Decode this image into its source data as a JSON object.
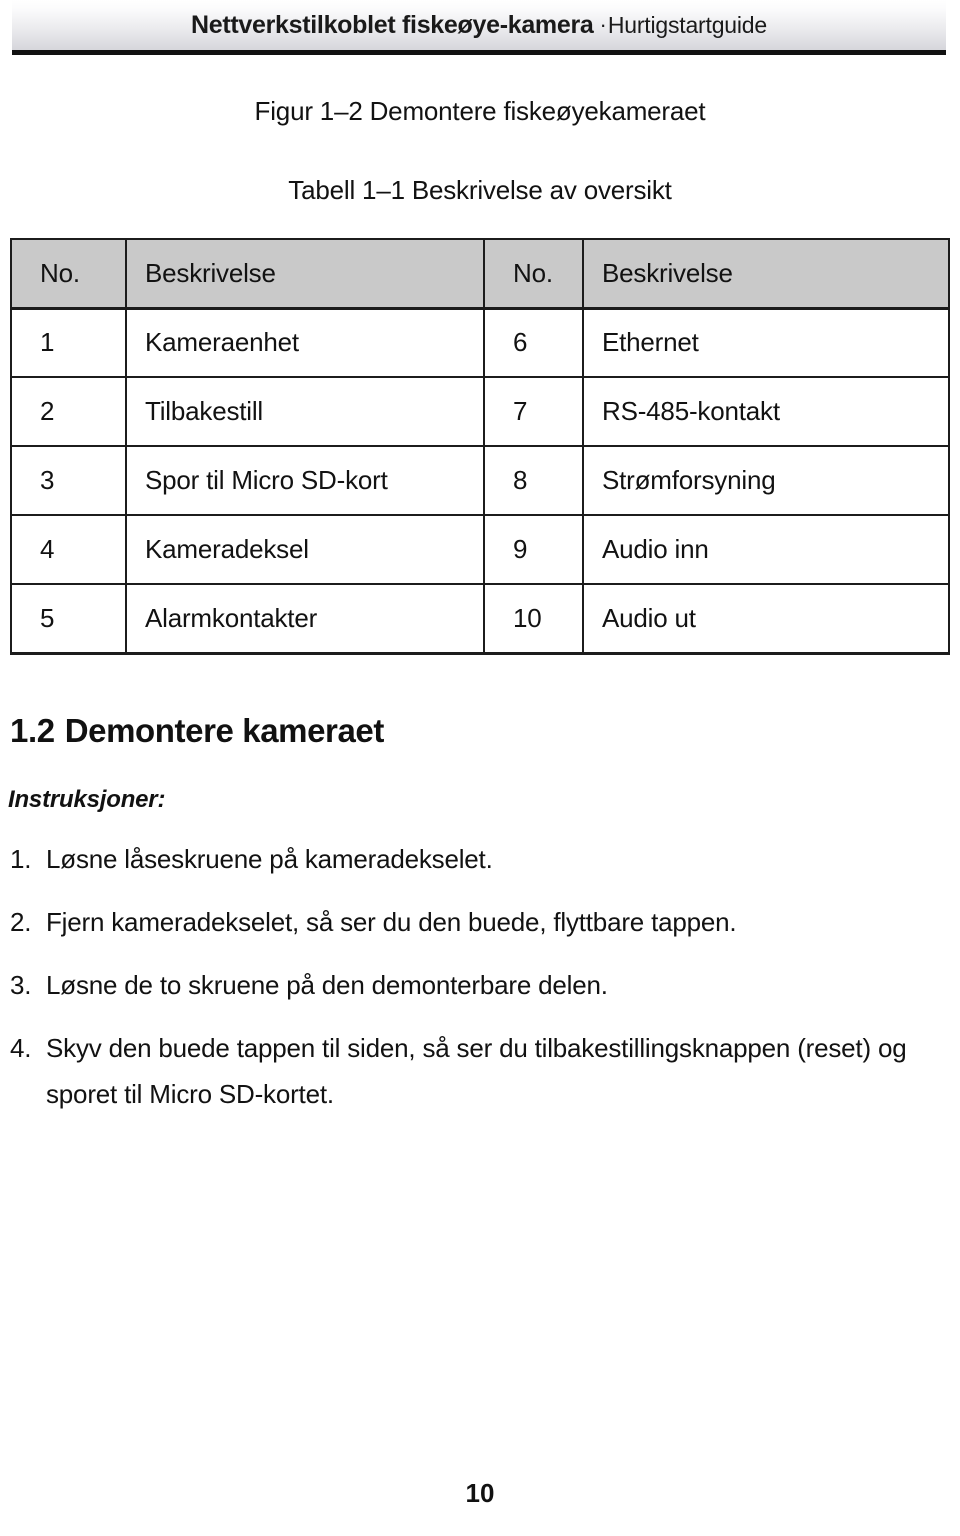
{
  "header": {
    "title_strong": "Nettverkstilkoblet fiskeøye-kamera",
    "separator": "·",
    "title_light": "Hurtigstartguide"
  },
  "figure_caption": "Figur 1–2 Demontere fiskeøyekameraet",
  "table_caption": "Tabell 1–1 Beskrivelse av oversikt",
  "table": {
    "headers": [
      "No.",
      "Beskrivelse",
      "No.",
      "Beskrivelse"
    ],
    "rows": [
      [
        "1",
        "Kameraenhet",
        "6",
        "Ethernet"
      ],
      [
        "2",
        "Tilbakestill",
        "7",
        "RS-485-kontakt"
      ],
      [
        "3",
        "Spor til Micro SD-kort",
        "8",
        "Strømforsyning"
      ],
      [
        "4",
        "Kameradeksel",
        "9",
        "Audio inn"
      ],
      [
        "5",
        "Alarmkontakter",
        "10",
        "Audio ut"
      ]
    ]
  },
  "section": {
    "number": "1.2",
    "title": "Demontere kameraet",
    "instructions_label": "Instruksjoner:",
    "steps": [
      {
        "num": "1.",
        "text": "Løsne låseskruene på kameradekselet."
      },
      {
        "num": "2.",
        "text": "Fjern kameradekselet, så ser du den buede, flyttbare tappen."
      },
      {
        "num": "3.",
        "text": "Løsne de to skruene på den demonterbare delen."
      },
      {
        "num": "4.",
        "text": "Skyv den buede tappen til siden, så ser du tilbakestillingsknappen (reset) og sporet til Micro SD-kortet."
      }
    ]
  },
  "page_number": "10",
  "colors": {
    "header_cell_background": "#c9c9c9",
    "table_border": "#1c1c1c",
    "text": "#121212"
  }
}
